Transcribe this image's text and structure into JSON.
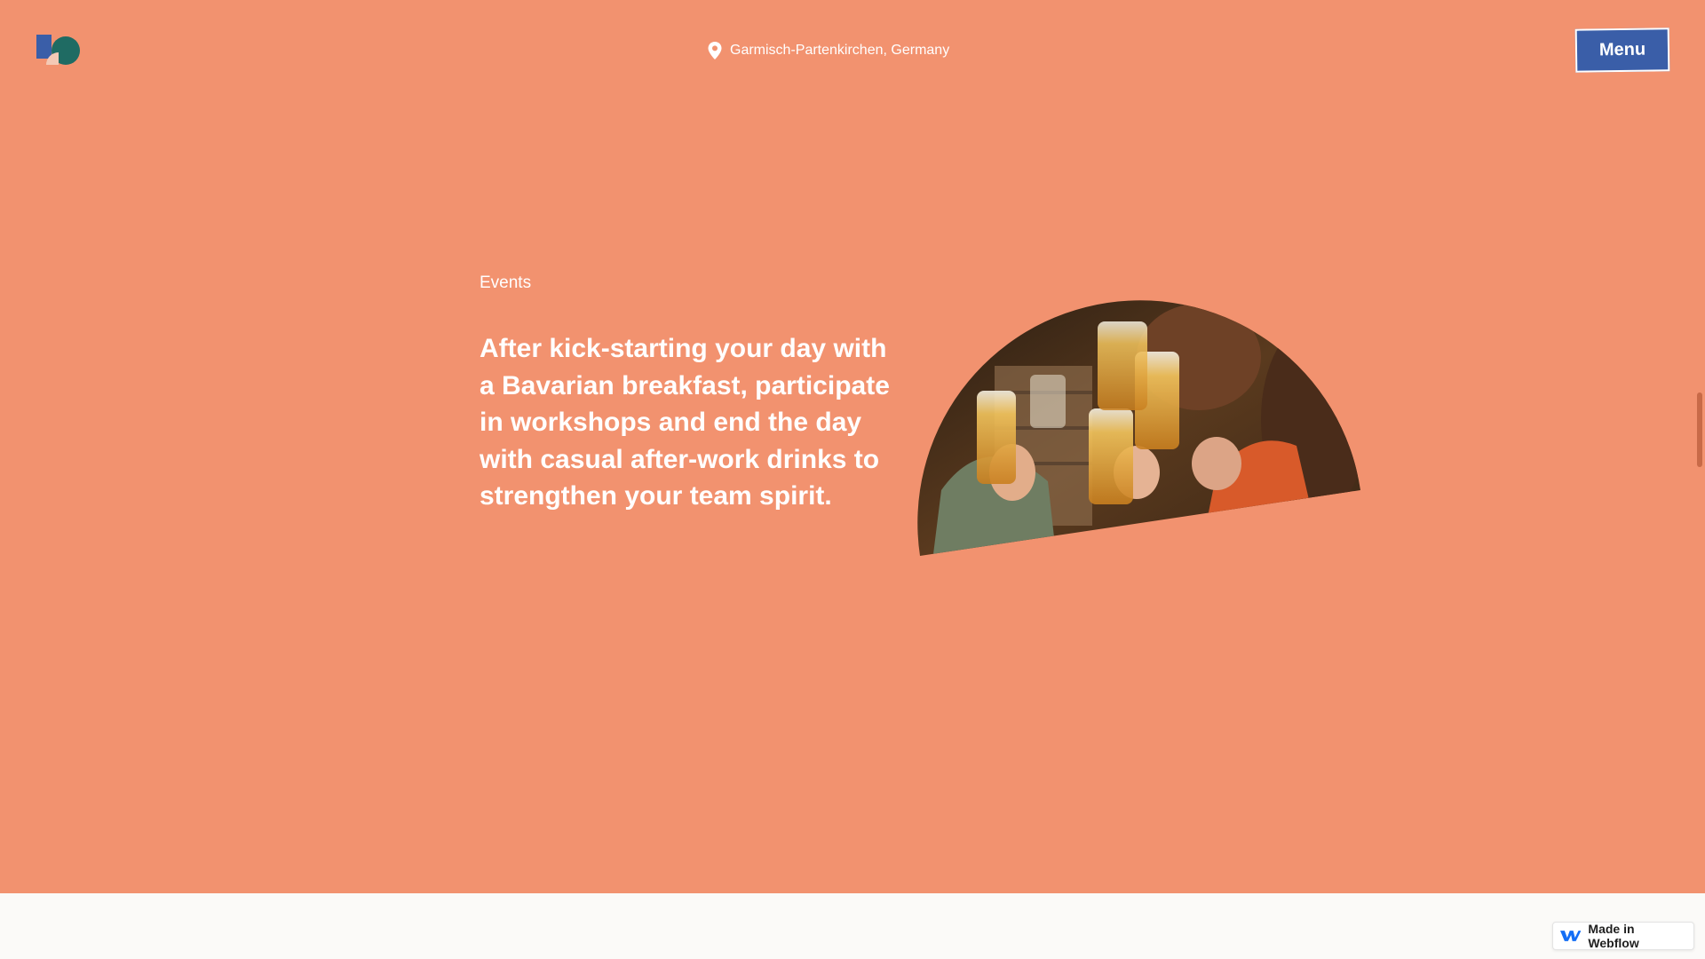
{
  "header": {
    "location": "Garmisch-Partenkirchen, Germany",
    "menu_label": "Menu",
    "icons": {
      "logo": "brand-logo",
      "pin": "map-pin-icon"
    }
  },
  "content": {
    "eyebrow": "Events",
    "headline": "After kick-starting your day with a Bavarian breakfast, participate in workshops and end the day with casual after-work drinks to strengthen your team spirit.",
    "image_icon": "cheers-photo"
  },
  "badge": {
    "label": "Made in Webflow",
    "icon": "webflow-logo-icon"
  },
  "colors": {
    "background": "#f2926f",
    "footer": "#fbfaf8",
    "menu_button": "#3a5ea8",
    "text": "#ffffff"
  }
}
